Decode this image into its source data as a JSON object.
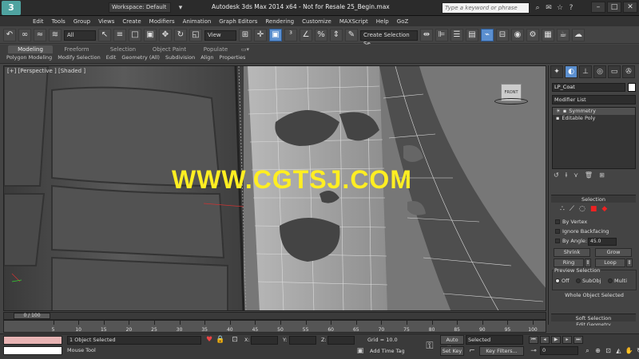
{
  "titlebar": {
    "workspace": "Workspace: Default",
    "window_title": "Autodesk 3ds Max  2014 x64   - Not for Resale    25_Begin.max",
    "search_placeholder": "Type a keyword or phrase"
  },
  "menu": [
    "Edit",
    "Tools",
    "Group",
    "Views",
    "Create",
    "Modifiers",
    "Animation",
    "Graph Editors",
    "Rendering",
    "Customize",
    "MAXScript",
    "Help",
    "GoZ"
  ],
  "toolbar": {
    "filter_dropdown": "All",
    "refcoord_dropdown": "View",
    "named_selection": "Create Selection Se"
  },
  "ribbon": {
    "tabs": [
      "Modeling",
      "Freeform",
      "Selection",
      "Object Paint",
      "Populate"
    ],
    "active_tab": "Modeling",
    "subpanels": [
      "Polygon Modeling",
      "Modify Selection",
      "Edit",
      "Geometry (All)",
      "Subdivision",
      "Align",
      "Properties"
    ]
  },
  "viewport": {
    "label": "[+] [Perspective ] [Shaded ]",
    "watermark": "WWW.CGTSJ.COM",
    "viewcube": "FRONT"
  },
  "cmdpanel": {
    "object_name": "LP_Coat",
    "modifier_list": "Modifier List",
    "stack": [
      "Symmetry",
      "Editable Poly"
    ],
    "selection_rollout": "Selection",
    "by_vertex": "By Vertex",
    "ignore_backfacing": "Ignore Backfacing",
    "by_angle": "By Angle:",
    "angle_value": "45.0",
    "shrink": "Shrink",
    "grow": "Grow",
    "ring": "Ring",
    "loop": "Loop",
    "preview_selection": "Preview Selection",
    "radio_off": "Off",
    "radio_subobj": "SubObj",
    "radio_multi": "Multi",
    "whole_object": "Whole Object Selected",
    "soft_selection": "Soft Selection",
    "edit_geometry": "Edit Geometry"
  },
  "timeline": {
    "slider": "0 / 100",
    "ticks": [
      5,
      10,
      15,
      20,
      25,
      30,
      35,
      40,
      45,
      50,
      55,
      60,
      65,
      70,
      75,
      80,
      85,
      90,
      95,
      100
    ]
  },
  "status": {
    "selection": "1 Object Selected",
    "prompt": "Mouse Tool",
    "x": "X:",
    "y": "Y:",
    "z": "Z:",
    "grid": "Grid = 10.0",
    "add_time_tag": "Add Time Tag",
    "auto_key": "Auto Key",
    "set_key": "Set Key",
    "selected": "Selected",
    "key_filters": "Key Filters...",
    "frame": "0"
  },
  "colors": {
    "watermark": "#ffee22",
    "active_blue": "#5b8fcf",
    "selection_red": "#ee2222"
  }
}
